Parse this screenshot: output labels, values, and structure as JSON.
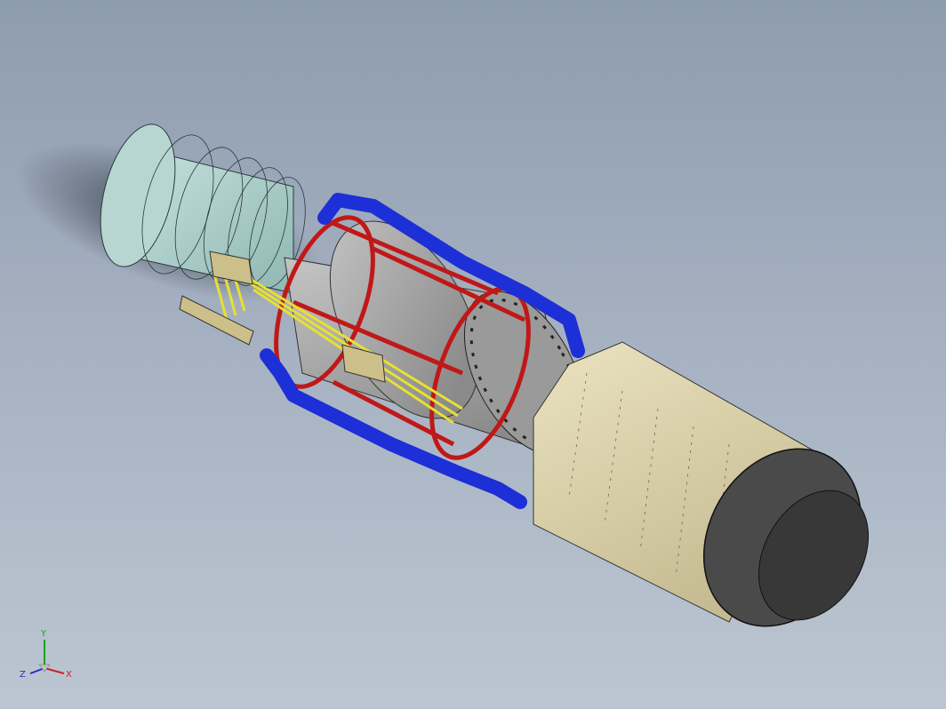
{
  "viewport": {
    "background_top": "#8e9cb0",
    "background_bottom": "#bcc6d2"
  },
  "model": {
    "colors": {
      "intake": "#a8ccc8",
      "core": "#a9a9a9",
      "nozzle_liner": "#d9cfa8",
      "nozzle_exit": "#4a4a4a",
      "red_frame": "#c01818",
      "blue_pipe": "#1d2fd6",
      "yellow_harness": "#e8e030",
      "connector": "#cdbf8a"
    }
  },
  "triad": {
    "x_label": "X",
    "y_label": "Y",
    "z_label": "Z",
    "x_color": "#d02020",
    "y_color": "#20a020",
    "z_color": "#2030c0"
  }
}
